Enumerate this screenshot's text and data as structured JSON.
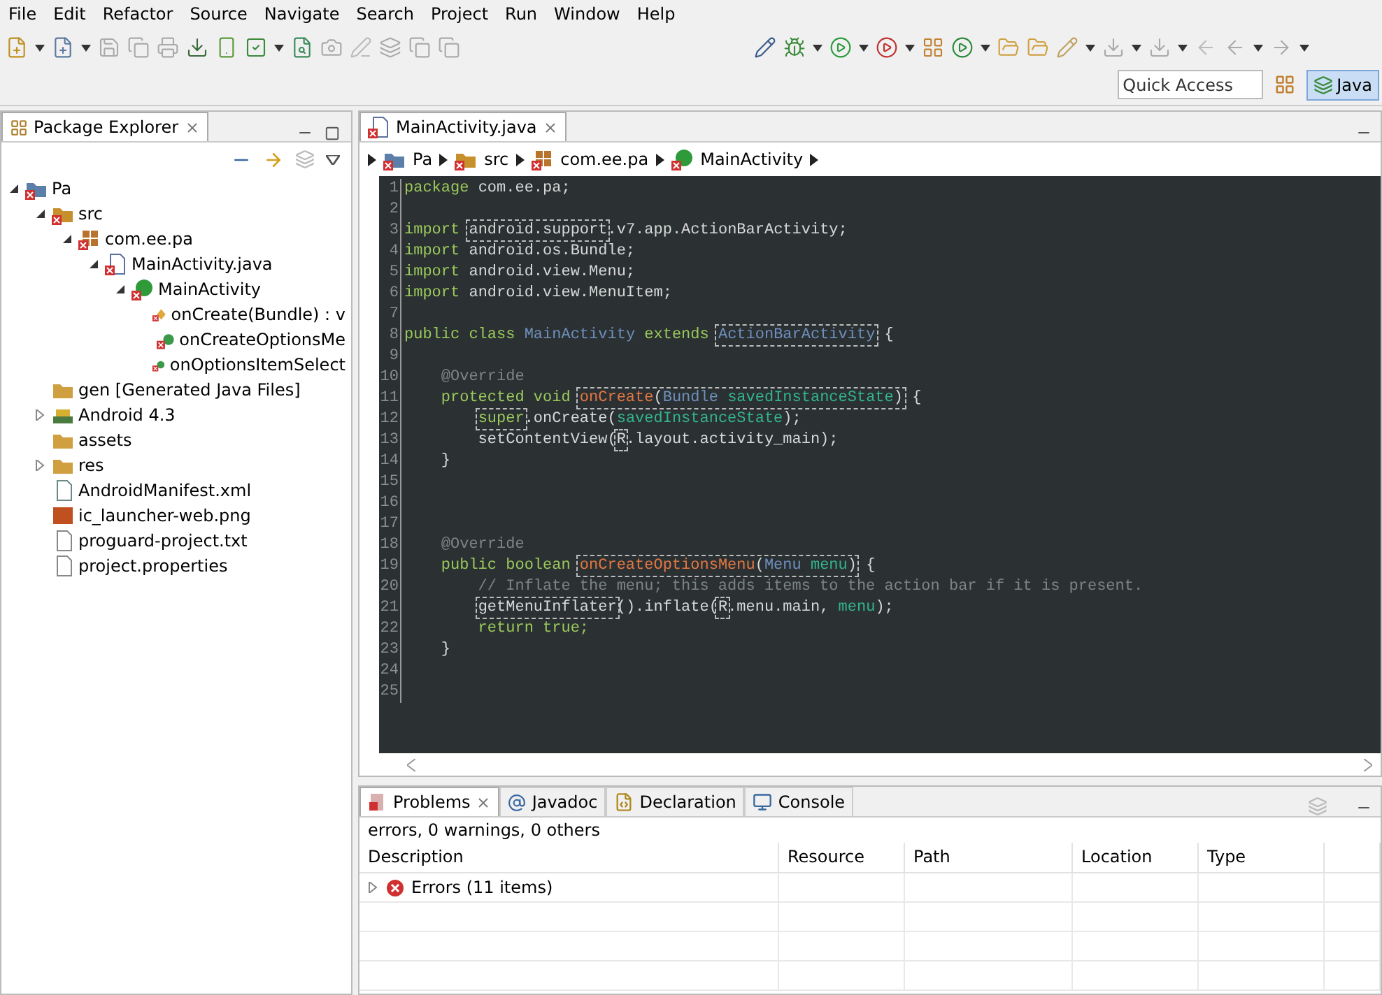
{
  "menu": [
    "File",
    "Edit",
    "Refactor",
    "Source",
    "Navigate",
    "Search",
    "Project",
    "Run",
    "Window",
    "Help"
  ],
  "quick_access": {
    "placeholder": "Quick Access"
  },
  "perspective": {
    "label": "Java",
    "selected": true
  },
  "package_explorer": {
    "title": "Package Explorer",
    "tree": [
      {
        "label": "Pa",
        "kind": "project",
        "error": true,
        "expanded": true,
        "children": [
          {
            "label": "src",
            "kind": "srcfolder",
            "error": true,
            "expanded": true,
            "children": [
              {
                "label": "com.ee.pa",
                "kind": "package",
                "error": true,
                "expanded": true,
                "children": [
                  {
                    "label": "MainActivity.java",
                    "kind": "javafile",
                    "error": true,
                    "expanded": true,
                    "children": [
                      {
                        "label": "MainActivity",
                        "kind": "class",
                        "error": true,
                        "expanded": true,
                        "children": [
                          {
                            "label": "onCreate(Bundle) : v",
                            "kind": "protectedmethod",
                            "error": true
                          },
                          {
                            "label": "onCreateOptionsMe",
                            "kind": "method",
                            "error": true
                          },
                          {
                            "label": "onOptionsItemSelect",
                            "kind": "method",
                            "error": true
                          }
                        ]
                      }
                    ]
                  }
                ]
              }
            ]
          },
          {
            "label": "gen [Generated Java Files]",
            "kind": "genfolder",
            "error": false
          },
          {
            "label": "Android 4.3",
            "kind": "library",
            "error": false,
            "expanded": false
          },
          {
            "label": "assets",
            "kind": "folder",
            "error": false
          },
          {
            "label": "res",
            "kind": "folder",
            "error": false,
            "expanded": false
          },
          {
            "label": "AndroidManifest.xml",
            "kind": "xml",
            "error": false
          },
          {
            "label": "ic_launcher-web.png",
            "kind": "image",
            "error": false
          },
          {
            "label": "proguard-project.txt",
            "kind": "text",
            "error": false
          },
          {
            "label": "project.properties",
            "kind": "text",
            "error": false
          }
        ]
      }
    ]
  },
  "editor": {
    "tabs": [
      {
        "label": "MainActivity.java",
        "selected": true
      }
    ],
    "breadcrumb": [
      {
        "label": "Pa",
        "kind": "project"
      },
      {
        "label": "src",
        "kind": "srcfolder"
      },
      {
        "label": "com.ee.pa",
        "kind": "package"
      },
      {
        "label": "MainActivity",
        "kind": "class"
      }
    ],
    "lines": [
      {
        "number": "1",
        "tokens": [
          {
            "text": "package",
            "kind": "keyword"
          },
          {
            "text": " com.ee.pa;",
            "kind": "plain"
          }
        ]
      },
      {
        "number": "2"
      },
      {
        "number": "3",
        "tokens": [
          {
            "text": "import ",
            "kind": "keyword"
          },
          {
            "kind": "box",
            "tokens": [
              {
                "text": "android.support",
                "kind": "plain"
              }
            ]
          },
          {
            "text": ".v7.app.ActionBarActivity;",
            "kind": "plain"
          }
        ]
      },
      {
        "number": "4",
        "tokens": [
          {
            "text": "import ",
            "kind": "keyword"
          },
          {
            "text": "android.os.Bundle;",
            "kind": "plain"
          }
        ]
      },
      {
        "number": "5",
        "tokens": [
          {
            "text": "import ",
            "kind": "keyword"
          },
          {
            "text": "android.view.Menu;",
            "kind": "plain"
          }
        ]
      },
      {
        "number": "6",
        "tokens": [
          {
            "text": "import ",
            "kind": "keyword"
          },
          {
            "text": "android.view.MenuItem;",
            "kind": "plain"
          }
        ]
      },
      {
        "number": "7"
      },
      {
        "number": "8",
        "tokens": [
          {
            "text": "public class ",
            "kind": "keyword"
          },
          {
            "text": "MainActivity",
            "kind": "type"
          },
          {
            "text": " extends ",
            "kind": "keyword"
          },
          {
            "kind": "box",
            "tokens": [
              {
                "text": "ActionBarActivity",
                "kind": "type"
              }
            ]
          },
          {
            "text": " {",
            "kind": "plain"
          }
        ]
      },
      {
        "number": "9"
      },
      {
        "number": "10",
        "tokens": [
          {
            "text": "    @Override",
            "kind": "annotation"
          }
        ]
      },
      {
        "number": "11",
        "tokens": [
          {
            "text": "    protected void ",
            "kind": "keyword"
          },
          {
            "kind": "box",
            "tokens": [
              {
                "text": "onCreate",
                "kind": "method"
              },
              {
                "text": "(",
                "kind": "plain"
              },
              {
                "text": "Bundle ",
                "kind": "type"
              },
              {
                "text": "savedInstanceState",
                "kind": "param"
              },
              {
                "text": ")",
                "kind": "plain"
              }
            ]
          },
          {
            "text": " {",
            "kind": "plain"
          }
        ]
      },
      {
        "number": "12",
        "tokens": [
          {
            "kind": "box",
            "tokens": [
              {
                "text": "        super",
                "kind": "keyword"
              }
            ]
          },
          {
            "text": ".onCreate(",
            "kind": "plain"
          },
          {
            "text": "savedInstanceState",
            "kind": "param"
          },
          {
            "text": ");",
            "kind": "plain"
          }
        ]
      },
      {
        "number": "13",
        "tokens": [
          {
            "text": "        setContentView(",
            "kind": "plain"
          },
          {
            "kind": "box",
            "tokens": [
              {
                "text": "R",
                "kind": "plain"
              }
            ]
          },
          {
            "text": ".layout.activity_main);",
            "kind": "plain"
          }
        ]
      },
      {
        "number": "14",
        "tokens": [
          {
            "text": "    }",
            "kind": "plain"
          }
        ]
      },
      {
        "number": "15"
      },
      {
        "number": "16"
      },
      {
        "number": "17"
      },
      {
        "number": "18",
        "tokens": [
          {
            "text": "    @Override",
            "kind": "annotation"
          }
        ]
      },
      {
        "number": "19",
        "tokens": [
          {
            "text": "    public boolean ",
            "kind": "keyword"
          },
          {
            "kind": "box",
            "tokens": [
              {
                "text": "onCreateOptionsMenu",
                "kind": "method"
              },
              {
                "text": "(",
                "kind": "plain"
              },
              {
                "text": "Menu ",
                "kind": "type"
              },
              {
                "text": "menu",
                "kind": "param"
              },
              {
                "text": ")",
                "kind": "plain"
              }
            ]
          },
          {
            "text": " {",
            "kind": "plain"
          }
        ]
      },
      {
        "number": "20",
        "tokens": [
          {
            "text": "        // Inflate the menu; this adds items to the action bar if it is present.",
            "kind": "comment"
          }
        ]
      },
      {
        "number": "21",
        "tokens": [
          {
            "kind": "box",
            "tokens": [
              {
                "text": "        getMenuInflater",
                "kind": "plain"
              }
            ]
          },
          {
            "text": "().inflate(",
            "kind": "plain"
          },
          {
            "kind": "box",
            "tokens": [
              {
                "text": "R",
                "kind": "plain"
              }
            ]
          },
          {
            "text": ".menu.main, ",
            "kind": "plain"
          },
          {
            "text": "menu",
            "kind": "param"
          },
          {
            "text": ");",
            "kind": "plain"
          }
        ]
      },
      {
        "number": "22",
        "tokens": [
          {
            "text": "        return true;",
            "kind": "keyword"
          }
        ]
      },
      {
        "number": "23",
        "tokens": [
          {
            "text": "    }",
            "kind": "plain"
          }
        ]
      },
      {
        "number": "24"
      },
      {
        "number": "25"
      }
    ]
  },
  "problems": {
    "tabs": [
      {
        "label": "Problems",
        "kind": "problems",
        "selected": true
      },
      {
        "label": "Javadoc",
        "kind": "javadoc",
        "selected": false
      },
      {
        "label": "Declaration",
        "kind": "declaration",
        "selected": false
      },
      {
        "label": "Console",
        "kind": "console",
        "selected": false
      }
    ],
    "summary": "errors, 0 warnings, 0 others",
    "columns": [
      "Description",
      "Resource",
      "Path",
      "Location",
      "Type"
    ],
    "rows": [
      {
        "description": "Errors (11 items)",
        "expanded": false
      }
    ]
  }
}
